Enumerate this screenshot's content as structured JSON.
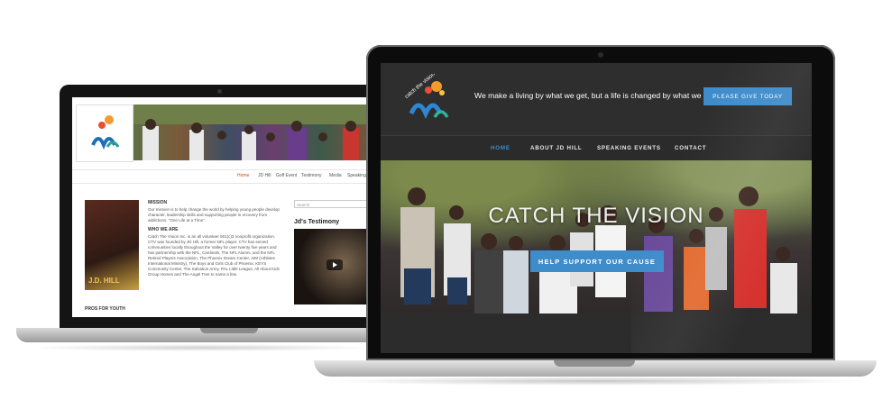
{
  "left_site": {
    "nav_items": [
      "Home",
      "JD Hill",
      "Golf Event",
      "Testimony",
      "Media",
      "Speaking"
    ],
    "book_title": "J.D. HILL",
    "mission_heading": "MISSION",
    "mission_text": "Our mission is to help change the world by helping young people develop character, leadership skills and supporting people in recovery from addictions. \"One Life at a Time\".",
    "who_heading": "WHO WE ARE",
    "who_text": "Catch The Vision Inc. is an all volunteer 501(c)3 nonprofit organization. CTV was founded by JD Hill, a former NFL player. CTV has served communities locally throughout the Valley for over twenty five years and has partnership with the NFL, Cardinals, The NFL Alumni, and the NFL Retired Players Association, The Phoenix Dream Center, AIM (Athletes International Ministry), The Boys and Girls Club of Phoenix, KEYS Community Center, The Salvation Army, PAL Little League, All About Kids Group Homes and The Angel Tree to name a few.",
    "footer_heading": "PROS FOR YOUTH",
    "search_placeholder": "Search",
    "sidebar_title": "Jd's Testimony"
  },
  "right_site": {
    "logo_text": "catch the vision",
    "tagline": "We make a living by what we get, but a life is changed by what we give.",
    "give_button": "PLEASE GIVE TODAY",
    "nav_items": [
      "HOME",
      "ABOUT JD HILL",
      "SPEAKING EVENTS",
      "CONTACT"
    ],
    "active_nav": "HOME",
    "hero_title": "CATCH THE VISION",
    "hero_button": "HELP SUPPORT OUR CAUSE"
  },
  "colors": {
    "accent": "#3f8ccb",
    "left_active_nav": "#d94a1e",
    "header_bg": "#2e2e2e"
  }
}
